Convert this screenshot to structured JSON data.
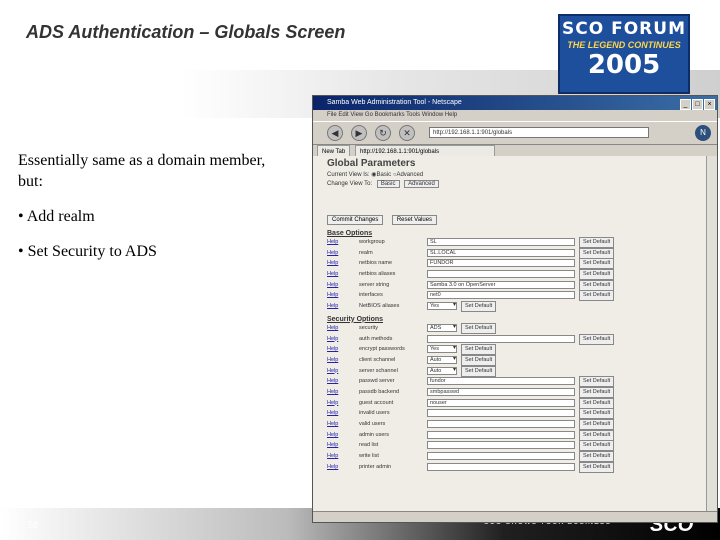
{
  "slide": {
    "title": "ADS Authentication – Globals Screen",
    "bullets_intro": "Essentially same as a domain member, but:",
    "bullets": [
      "• Add realm",
      "• Set Security to ADS"
    ],
    "page_number": "58"
  },
  "logo": {
    "line1": "SCO FORUM",
    "line2": "THE LEGEND CONTINUES",
    "line3": "2005"
  },
  "footer": {
    "tagline": "SCO GROWS YOUR BUSINESS",
    "logo": "SCO"
  },
  "browser": {
    "title": "Samba Web Administration Tool - Netscape",
    "menu": "File  Edit  View  Go  Bookmarks  Tools  Window  Help",
    "url": "http://192.168.1.1:901/globals",
    "tabs": [
      "New Tab",
      "http://192.168.1.1:901/globals"
    ],
    "window_buttons": [
      "_",
      "□",
      "×"
    ],
    "nav_icons": [
      "back-icon",
      "forward-icon",
      "reload-icon",
      "stop-icon"
    ]
  },
  "swat": {
    "page_title": "Global Parameters",
    "current_view_label": "Current View Is:",
    "view_options": [
      "Basic",
      "Advanced"
    ],
    "change_view_label": "Change View To:",
    "change_view_buttons": [
      "Basic",
      "Advanced"
    ],
    "action_buttons": [
      "Commit Changes",
      "Reset Values"
    ],
    "help_label": "Help",
    "default_label": "Set Default",
    "base_section": "Base Options",
    "base_rows": [
      {
        "label": "workgroup",
        "value": "SL",
        "type": "text"
      },
      {
        "label": "realm",
        "value": "SL.LOCAL",
        "type": "text"
      },
      {
        "label": "netbios name",
        "value": "FUNDOR",
        "type": "text"
      },
      {
        "label": "netbios aliases",
        "value": "",
        "type": "text"
      },
      {
        "label": "server string",
        "value": "Samba 3.0 on OpenServer",
        "type": "text"
      },
      {
        "label": "interfaces",
        "value": "net0",
        "type": "text"
      },
      {
        "label": "NetBIOS aliases",
        "value": "Yes",
        "type": "select"
      }
    ],
    "security_section": "Security Options",
    "security_rows": [
      {
        "label": "security",
        "value": "ADS",
        "type": "select"
      },
      {
        "label": "auth methods",
        "value": "",
        "type": "text"
      },
      {
        "label": "encrypt passwords",
        "value": "Yes",
        "type": "select"
      },
      {
        "label": "client schannel",
        "value": "Auto",
        "type": "select"
      },
      {
        "label": "server schannel",
        "value": "Auto",
        "type": "select"
      },
      {
        "label": "passwd server",
        "value": "fundor",
        "type": "text"
      },
      {
        "label": "passdb backend",
        "value": "smbpasswd",
        "type": "text"
      },
      {
        "label": "guest account",
        "value": "nouser",
        "type": "text"
      },
      {
        "label": "invalid users",
        "value": "",
        "type": "text"
      },
      {
        "label": "valid users",
        "value": "",
        "type": "text"
      },
      {
        "label": "admin users",
        "value": "",
        "type": "text"
      },
      {
        "label": "read list",
        "value": "",
        "type": "text"
      },
      {
        "label": "write list",
        "value": "",
        "type": "text"
      },
      {
        "label": "printer admin",
        "value": "",
        "type": "text"
      }
    ]
  }
}
